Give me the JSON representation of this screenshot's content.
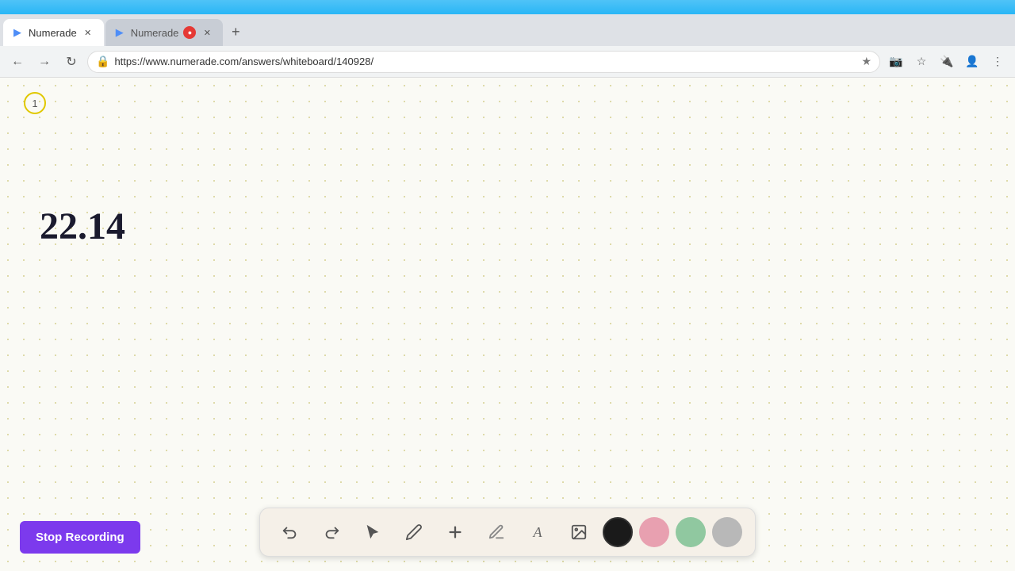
{
  "browser": {
    "top_bar_color": "#29b6f6",
    "tabs": [
      {
        "id": "tab1",
        "label": "Numerade",
        "active": true,
        "recording": false,
        "favicon": "▶"
      },
      {
        "id": "tab2",
        "label": "Numerade",
        "active": false,
        "recording": true,
        "favicon": "▶"
      }
    ],
    "new_tab_label": "+",
    "address": "https://www.numerade.com/answers/whiteboard/140928/",
    "nav_buttons": {
      "back": "←",
      "forward": "→",
      "refresh": "↻"
    }
  },
  "whiteboard": {
    "page_number": "1",
    "content_text": "22.14",
    "background_dot_color": "#d4d090"
  },
  "toolbar": {
    "buttons": [
      {
        "id": "undo",
        "label": "↩",
        "title": "Undo"
      },
      {
        "id": "redo",
        "label": "↪",
        "title": "Redo"
      },
      {
        "id": "select",
        "label": "↖",
        "title": "Select"
      },
      {
        "id": "pencil",
        "label": "✏",
        "title": "Draw"
      },
      {
        "id": "add",
        "label": "+",
        "title": "Add"
      },
      {
        "id": "highlighter",
        "label": "✍",
        "title": "Highlight"
      },
      {
        "id": "text",
        "label": "A",
        "title": "Text"
      },
      {
        "id": "image",
        "label": "🖼",
        "title": "Image"
      }
    ],
    "colors": [
      {
        "id": "black",
        "value": "#1a1a1a",
        "active": true
      },
      {
        "id": "pink",
        "value": "#e8a0b0",
        "active": false
      },
      {
        "id": "green",
        "value": "#90c8a0",
        "active": false
      },
      {
        "id": "gray",
        "value": "#b8b8b8",
        "active": false
      }
    ]
  },
  "stop_recording_button": {
    "label": "Stop Recording",
    "bg_color": "#7c3aed"
  }
}
